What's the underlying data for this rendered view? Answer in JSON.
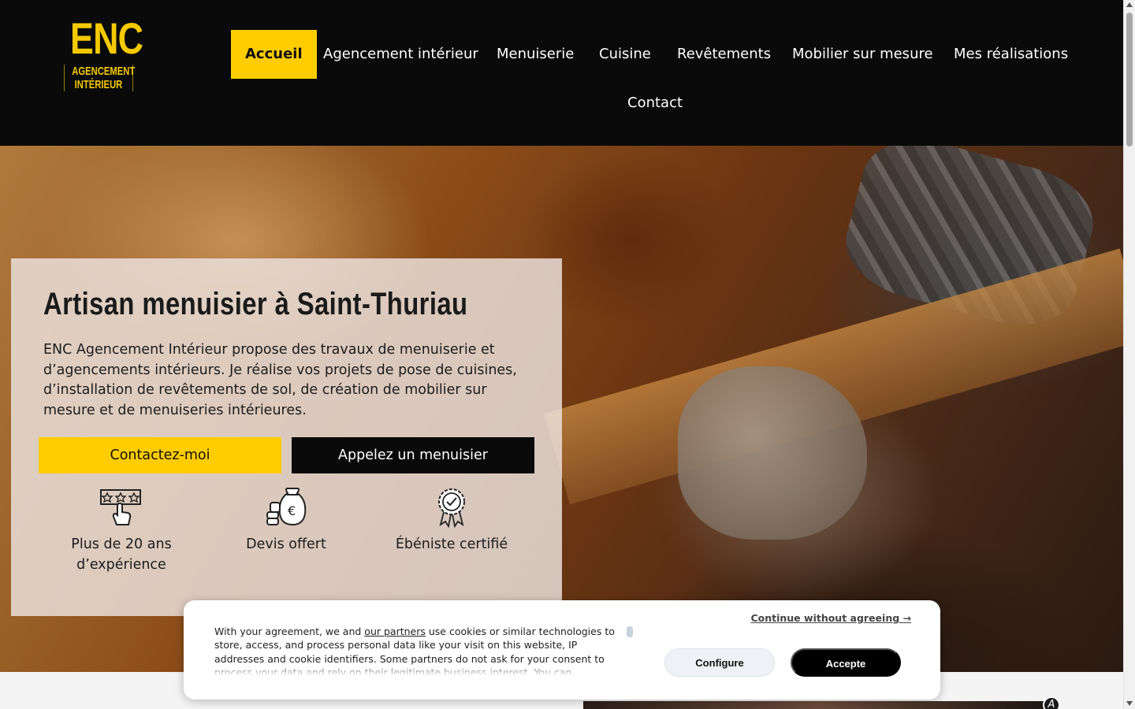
{
  "brand": {
    "logo_main": "ENC",
    "logo_line1": "AGENCEMENT",
    "logo_line2": "INTÉRIEUR"
  },
  "nav": {
    "items": [
      {
        "label": "Accueil",
        "active": true
      },
      {
        "label": "Agencement intérieur"
      },
      {
        "label": "Menuiserie"
      },
      {
        "label": "Cuisine"
      },
      {
        "label": "Revêtements"
      },
      {
        "label": "Mobilier sur mesure"
      },
      {
        "label": "Mes réalisations"
      },
      {
        "label": "Contact"
      }
    ]
  },
  "hero": {
    "title": "Artisan menuisier à Saint-Thuriau",
    "description": "ENC Agencement Intérieur propose des travaux de menuiserie et d’agencements intérieurs. Je réalise vos projets de pose de cuisines, d’installation de revêtements de sol, de création de mobilier sur mesure et de menuiseries intérieures.",
    "cta_primary": "Contactez-moi",
    "cta_secondary": "Appelez un menuisier",
    "features": [
      {
        "icon": "star-rating-hand-icon",
        "label": "Plus de 20 ans d’expérience"
      },
      {
        "icon": "money-bag-euro-icon",
        "label": "Devis offert"
      },
      {
        "icon": "certified-ribbon-icon",
        "label": "Ébéniste certifié"
      }
    ]
  },
  "cookie_banner": {
    "text_before_link": "With your agreement, we and ",
    "link": "our partners",
    "text_after_link": " use cookies or similar technologies to store, access, and process personal data like your visit on this website, IP addresses and cookie identifiers. Some partners do not ask for your consent to process your data and rely on their legitimate business interest. You can",
    "continue_label": "Continue without agreeing →",
    "configure_label": "Configure",
    "accept_label": "Accepte"
  },
  "colors": {
    "accent": "#ffcc00",
    "header_bg": "#0a0a0a",
    "text": "#1c1c1c"
  }
}
